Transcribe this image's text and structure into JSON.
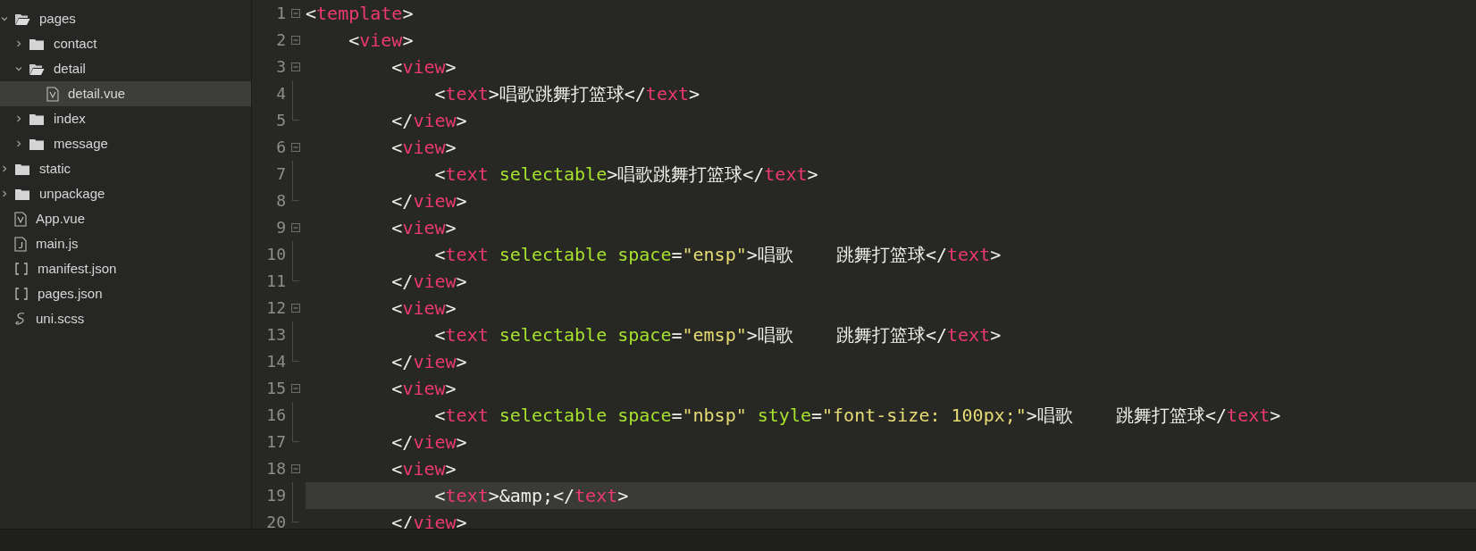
{
  "sidebar": {
    "items": [
      {
        "label": "pages",
        "kind": "folder",
        "expanded": true,
        "selected": false,
        "children": [
          {
            "label": "contact",
            "kind": "folder",
            "expanded": false,
            "selected": false
          },
          {
            "label": "detail",
            "kind": "folder",
            "expanded": true,
            "selected": false,
            "children": [
              {
                "label": "detail.vue",
                "kind": "vue",
                "selected": true
              }
            ]
          },
          {
            "label": "index",
            "kind": "folder",
            "expanded": false,
            "selected": false
          },
          {
            "label": "message",
            "kind": "folder",
            "expanded": false,
            "selected": false
          }
        ]
      },
      {
        "label": "static",
        "kind": "folder",
        "expanded": false,
        "selected": false
      },
      {
        "label": "unpackage",
        "kind": "folder",
        "expanded": false,
        "selected": false
      },
      {
        "label": "App.vue",
        "kind": "vue",
        "selected": false
      },
      {
        "label": "main.js",
        "kind": "js",
        "selected": false
      },
      {
        "label": "manifest.json",
        "kind": "json",
        "selected": false
      },
      {
        "label": "pages.json",
        "kind": "json",
        "selected": false
      },
      {
        "label": "uni.scss",
        "kind": "scss",
        "selected": false
      }
    ]
  },
  "editor": {
    "lines": [
      {
        "number": "1",
        "fold_start": true,
        "fold_end": false,
        "current": false,
        "tokens": [
          {
            "kind": "punct",
            "text": "<"
          },
          {
            "kind": "tag",
            "text": "template"
          },
          {
            "kind": "punct",
            "text": ">"
          }
        ]
      },
      {
        "number": "2",
        "fold_start": true,
        "fold_end": false,
        "current": false,
        "tokens": [
          {
            "kind": "punct",
            "text": "    <"
          },
          {
            "kind": "tag",
            "text": "view"
          },
          {
            "kind": "punct",
            "text": ">"
          }
        ]
      },
      {
        "number": "3",
        "fold_start": true,
        "fold_end": false,
        "current": false,
        "tokens": [
          {
            "kind": "punct",
            "text": "        <"
          },
          {
            "kind": "tag",
            "text": "view"
          },
          {
            "kind": "punct",
            "text": ">"
          }
        ]
      },
      {
        "number": "4",
        "fold_start": false,
        "fold_end": false,
        "current": false,
        "tokens": [
          {
            "kind": "punct",
            "text": "            <"
          },
          {
            "kind": "tag",
            "text": "text"
          },
          {
            "kind": "punct",
            "text": ">唱歌跳舞打篮球</"
          },
          {
            "kind": "tag",
            "text": "text"
          },
          {
            "kind": "punct",
            "text": ">"
          }
        ]
      },
      {
        "number": "5",
        "fold_start": false,
        "fold_end": true,
        "current": false,
        "tokens": [
          {
            "kind": "punct",
            "text": "        </"
          },
          {
            "kind": "tag",
            "text": "view"
          },
          {
            "kind": "punct",
            "text": ">"
          }
        ]
      },
      {
        "number": "6",
        "fold_start": true,
        "fold_end": false,
        "current": false,
        "tokens": [
          {
            "kind": "punct",
            "text": "        <"
          },
          {
            "kind": "tag",
            "text": "view"
          },
          {
            "kind": "punct",
            "text": ">"
          }
        ]
      },
      {
        "number": "7",
        "fold_start": false,
        "fold_end": false,
        "current": false,
        "tokens": [
          {
            "kind": "punct",
            "text": "            <"
          },
          {
            "kind": "tag",
            "text": "text"
          },
          {
            "kind": "attr",
            "text": " selectable"
          },
          {
            "kind": "punct",
            "text": ">唱歌跳舞打篮球</"
          },
          {
            "kind": "tag",
            "text": "text"
          },
          {
            "kind": "punct",
            "text": ">"
          }
        ]
      },
      {
        "number": "8",
        "fold_start": false,
        "fold_end": true,
        "current": false,
        "tokens": [
          {
            "kind": "punct",
            "text": "        </"
          },
          {
            "kind": "tag",
            "text": "view"
          },
          {
            "kind": "punct",
            "text": ">"
          }
        ]
      },
      {
        "number": "9",
        "fold_start": true,
        "fold_end": false,
        "current": false,
        "tokens": [
          {
            "kind": "punct",
            "text": "        <"
          },
          {
            "kind": "tag",
            "text": "view"
          },
          {
            "kind": "punct",
            "text": ">"
          }
        ]
      },
      {
        "number": "10",
        "fold_start": false,
        "fold_end": false,
        "current": false,
        "tokens": [
          {
            "kind": "punct",
            "text": "            <"
          },
          {
            "kind": "tag",
            "text": "text"
          },
          {
            "kind": "attr",
            "text": " selectable space"
          },
          {
            "kind": "punct",
            "text": "="
          },
          {
            "kind": "string",
            "text": "\"ensp\""
          },
          {
            "kind": "punct",
            "text": ">唱歌    跳舞打篮球</"
          },
          {
            "kind": "tag",
            "text": "text"
          },
          {
            "kind": "punct",
            "text": ">"
          }
        ]
      },
      {
        "number": "11",
        "fold_start": false,
        "fold_end": true,
        "current": false,
        "tokens": [
          {
            "kind": "punct",
            "text": "        </"
          },
          {
            "kind": "tag",
            "text": "view"
          },
          {
            "kind": "punct",
            "text": ">"
          }
        ]
      },
      {
        "number": "12",
        "fold_start": true,
        "fold_end": false,
        "current": false,
        "tokens": [
          {
            "kind": "punct",
            "text": "        <"
          },
          {
            "kind": "tag",
            "text": "view"
          },
          {
            "kind": "punct",
            "text": ">"
          }
        ]
      },
      {
        "number": "13",
        "fold_start": false,
        "fold_end": false,
        "current": false,
        "tokens": [
          {
            "kind": "punct",
            "text": "            <"
          },
          {
            "kind": "tag",
            "text": "text"
          },
          {
            "kind": "attr",
            "text": " selectable space"
          },
          {
            "kind": "punct",
            "text": "="
          },
          {
            "kind": "string",
            "text": "\"emsp\""
          },
          {
            "kind": "punct",
            "text": ">唱歌    跳舞打篮球</"
          },
          {
            "kind": "tag",
            "text": "text"
          },
          {
            "kind": "punct",
            "text": ">"
          }
        ]
      },
      {
        "number": "14",
        "fold_start": false,
        "fold_end": true,
        "current": false,
        "tokens": [
          {
            "kind": "punct",
            "text": "        </"
          },
          {
            "kind": "tag",
            "text": "view"
          },
          {
            "kind": "punct",
            "text": ">"
          }
        ]
      },
      {
        "number": "15",
        "fold_start": true,
        "fold_end": false,
        "current": false,
        "tokens": [
          {
            "kind": "punct",
            "text": "        <"
          },
          {
            "kind": "tag",
            "text": "view"
          },
          {
            "kind": "punct",
            "text": ">"
          }
        ]
      },
      {
        "number": "16",
        "fold_start": false,
        "fold_end": false,
        "current": false,
        "tokens": [
          {
            "kind": "punct",
            "text": "            <"
          },
          {
            "kind": "tag",
            "text": "text"
          },
          {
            "kind": "attr",
            "text": " selectable space"
          },
          {
            "kind": "punct",
            "text": "="
          },
          {
            "kind": "string",
            "text": "\"nbsp\""
          },
          {
            "kind": "attr",
            "text": " style"
          },
          {
            "kind": "punct",
            "text": "="
          },
          {
            "kind": "string",
            "text": "\"font-size: 100px;\""
          },
          {
            "kind": "punct",
            "text": ">唱歌    跳舞打篮球</"
          },
          {
            "kind": "tag",
            "text": "text"
          },
          {
            "kind": "punct",
            "text": ">"
          }
        ]
      },
      {
        "number": "17",
        "fold_start": false,
        "fold_end": true,
        "current": false,
        "tokens": [
          {
            "kind": "punct",
            "text": "        </"
          },
          {
            "kind": "tag",
            "text": "view"
          },
          {
            "kind": "punct",
            "text": ">"
          }
        ]
      },
      {
        "number": "18",
        "fold_start": true,
        "fold_end": false,
        "current": false,
        "tokens": [
          {
            "kind": "punct",
            "text": "        <"
          },
          {
            "kind": "tag",
            "text": "view"
          },
          {
            "kind": "punct",
            "text": ">"
          }
        ]
      },
      {
        "number": "19",
        "fold_start": false,
        "fold_end": false,
        "current": true,
        "tokens": [
          {
            "kind": "punct",
            "text": "            <"
          },
          {
            "kind": "tag",
            "text": "text"
          },
          {
            "kind": "punct",
            "text": ">&amp;</"
          },
          {
            "kind": "tag",
            "text": "text"
          },
          {
            "kind": "punct",
            "text": ">"
          }
        ]
      },
      {
        "number": "20",
        "fold_start": false,
        "fold_end": true,
        "current": false,
        "tokens": [
          {
            "kind": "punct",
            "text": "        </"
          },
          {
            "kind": "tag",
            "text": "view"
          },
          {
            "kind": "punct",
            "text": ">"
          }
        ]
      }
    ]
  }
}
